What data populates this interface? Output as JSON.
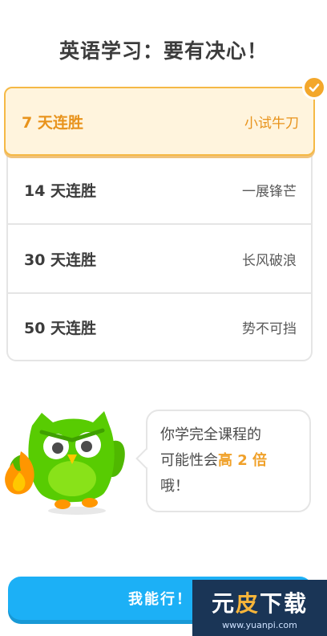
{
  "title": "英语学习：要有决心！",
  "options": [
    {
      "streak": "7 天连胜",
      "tag": "小试牛刀",
      "selected": true
    },
    {
      "streak": "14 天连胜",
      "tag": "一展锋芒",
      "selected": false
    },
    {
      "streak": "30 天连胜",
      "tag": "长风破浪",
      "selected": false
    },
    {
      "streak": "50 天连胜",
      "tag": "势不可挡",
      "selected": false
    }
  ],
  "bubble": {
    "line1": "你学完全课程的",
    "line2_prefix": "可能性会",
    "line2_highlight": "高 2 倍",
    "line3": "哦！"
  },
  "cta": {
    "label": "我能行！"
  },
  "watermark": {
    "text": "元皮下载",
    "url": "www.yuanpi.com"
  },
  "colors": {
    "accent": "#f3a72b",
    "button": "#1cb0f6",
    "owl": "#58cc02"
  },
  "icons": {
    "badge": "checkmark-icon",
    "mascot": "owl-mascot",
    "flame": "flame-icon"
  }
}
